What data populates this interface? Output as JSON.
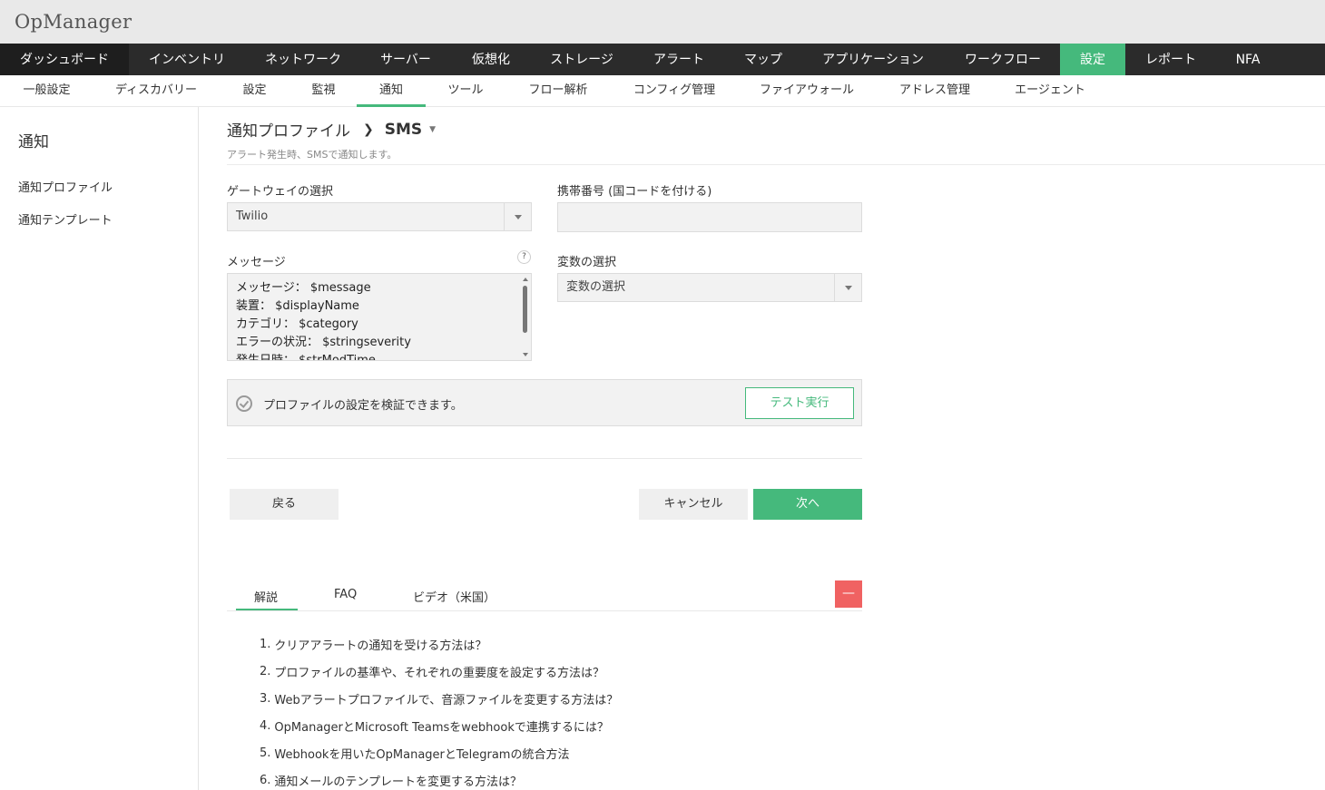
{
  "app": {
    "title": "OpManager"
  },
  "main_nav": [
    {
      "label": "ダッシュボード"
    },
    {
      "label": "インベントリ"
    },
    {
      "label": "ネットワーク"
    },
    {
      "label": "サーバー"
    },
    {
      "label": "仮想化"
    },
    {
      "label": "ストレージ"
    },
    {
      "label": "アラート"
    },
    {
      "label": "マップ"
    },
    {
      "label": "アプリケーション"
    },
    {
      "label": "ワークフロー"
    },
    {
      "label": "設定"
    },
    {
      "label": "レポート"
    },
    {
      "label": "NFA"
    }
  ],
  "sub_nav": [
    {
      "label": "一般設定"
    },
    {
      "label": "ディスカバリー"
    },
    {
      "label": "設定"
    },
    {
      "label": "監視"
    },
    {
      "label": "通知"
    },
    {
      "label": "ツール"
    },
    {
      "label": "フロー解析"
    },
    {
      "label": "コンフィグ管理"
    },
    {
      "label": "ファイアウォール"
    },
    {
      "label": "アドレス管理"
    },
    {
      "label": "エージェント"
    }
  ],
  "sidebar": {
    "title": "通知",
    "items": [
      {
        "label": "通知プロファイル"
      },
      {
        "label": "通知テンプレート"
      }
    ]
  },
  "page": {
    "breadcrumb_parent": "通知プロファイル",
    "breadcrumb_current": "SMS",
    "subtitle": "アラート発生時、SMSで通知します。"
  },
  "form": {
    "gateway_label": "ゲートウェイの選択",
    "gateway_value": "Twilio",
    "mobile_label": "携帯番号 (国コードを付ける)",
    "mobile_value": "",
    "message_label": "メッセージ",
    "message_lines": [
      "メッセージ： $message",
      "装置： $displayName",
      "カテゴリ： $category",
      "エラーの状況： $stringseverity",
      "発生日時： $strModTime"
    ],
    "variable_label": "変数の選択",
    "variable_value": "変数の選択"
  },
  "verify": {
    "text": "プロファイルの設定を検証できます。",
    "test_label": "テスト実行"
  },
  "actions": {
    "back": "戻る",
    "cancel": "キャンセル",
    "next": "次へ"
  },
  "help_tabs": [
    {
      "label": "解説"
    },
    {
      "label": "FAQ"
    },
    {
      "label": "ビデオ（米国）"
    }
  ],
  "faqs": [
    {
      "num": "1.",
      "text": "クリアアラートの通知を受ける方法は？"
    },
    {
      "num": "2.",
      "text": "プロファイルの基準や、それぞれの重要度を設定する方法は？"
    },
    {
      "num": "3.",
      "text": "Webアラートプロファイルで、音源ファイルを変更する方法は？"
    },
    {
      "num": "4.",
      "text": "OpManagerとMicrosoft Teamsをwebhookで連携するには？"
    },
    {
      "num": "5.",
      "text": "Webhookを用いたOpManagerとTelegramの統合方法"
    },
    {
      "num": "6.",
      "text": "通知メールのテンプレートを変更する方法は？"
    }
  ],
  "colors": {
    "accent": "#45b97c",
    "nav_bg": "#2b2b2b",
    "danger": "#f06262"
  },
  "icons": {
    "help": "question-icon",
    "verify": "check-circle-icon",
    "collapse": "minus-icon"
  },
  "labels": {
    "help_mark": "?",
    "collapse_mark": "—"
  }
}
